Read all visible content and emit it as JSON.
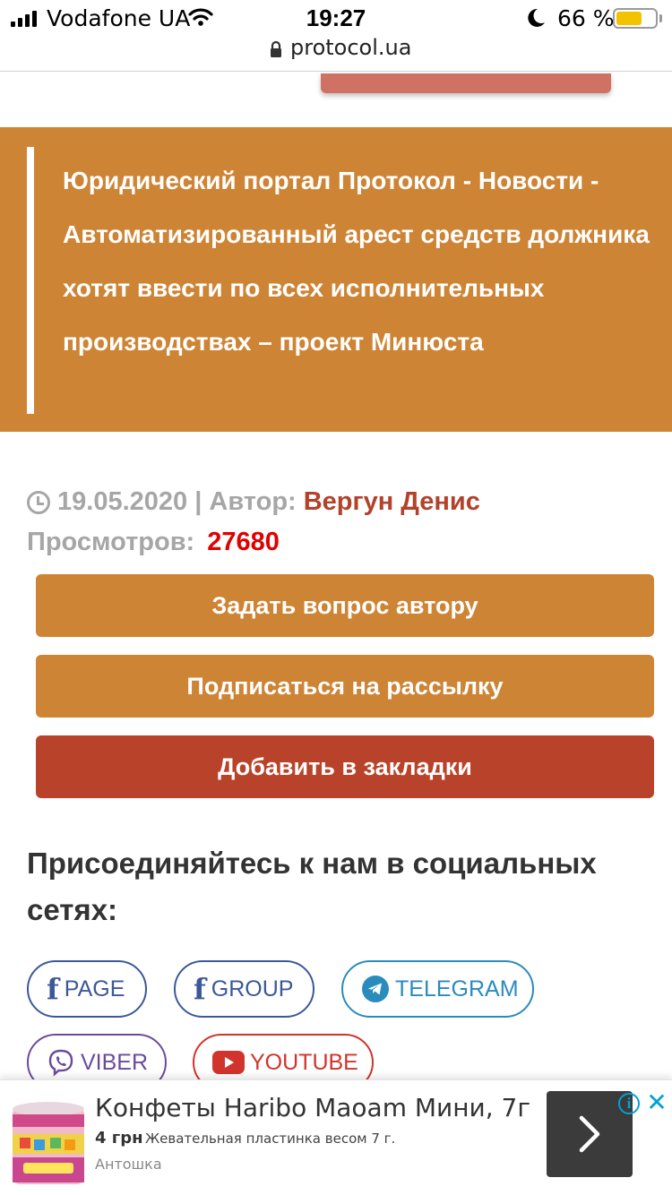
{
  "status_bar": {
    "carrier": "Vodafone UA",
    "time": "19:27",
    "battery_percent": "66 %",
    "battery_level": 0.66
  },
  "browser": {
    "url": "protocol.ua"
  },
  "breadcrumb": {
    "portal": "Юридический портал Протокол",
    "separator": " - ",
    "section": "Новости",
    "article": "Автоматизированный арест средств должника хотят ввести по всех исполнительных производствах – проект Минюста"
  },
  "meta": {
    "date": "19.05.2020",
    "divider": "|",
    "author_label": "Автор:",
    "author_name": "Вергун Денис",
    "views_label": "Просмотров:",
    "views_count": "27680"
  },
  "actions": {
    "ask_author": "Задать вопрос автору",
    "subscribe": "Подписаться на рассылку",
    "bookmark": "Добавить в закладки"
  },
  "social": {
    "title": "Присоединяйтесь к нам в социальных сетях:",
    "links": [
      {
        "label": "PAGE",
        "icon": "facebook-icon"
      },
      {
        "label": "GROUP",
        "icon": "facebook-icon"
      },
      {
        "label": "TELEGRAM",
        "icon": "telegram-icon"
      },
      {
        "label": "VIBER",
        "icon": "viber-icon"
      },
      {
        "label": "YOUTUBE",
        "icon": "youtube-icon"
      }
    ]
  },
  "ad": {
    "title": "Конфеты Haribo Maoam Мини, 7г",
    "price": "4 грн",
    "description": "Жевательная пластинка весом 7 г.",
    "shop": "Антошка",
    "info_glyph": "i",
    "close_glyph": "✕"
  },
  "colors": {
    "brand_orange": "#cd8434",
    "brand_red": "#b9432a",
    "author_red": "#b2422b",
    "views_red": "#e00000",
    "facebook": "#3b5998",
    "telegram": "#2a8bbd",
    "viber": "#6b4a9b",
    "youtube": "#d0342c"
  }
}
